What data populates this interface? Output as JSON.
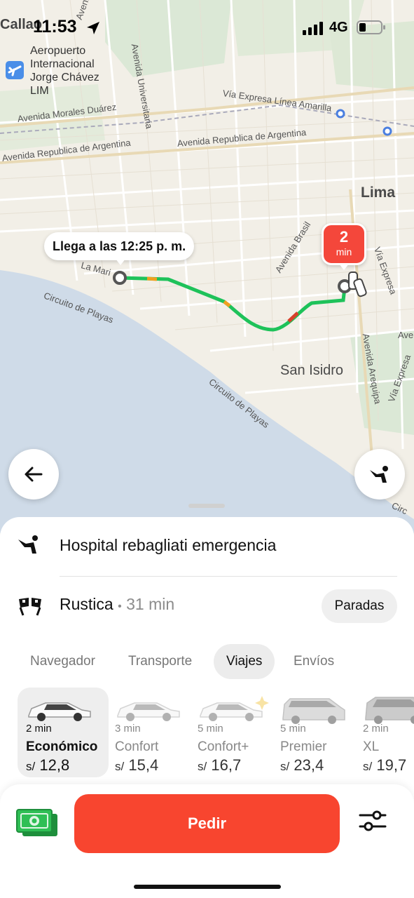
{
  "status_bar": {
    "time": "11:53",
    "network": "4G",
    "corner_label": "Callao"
  },
  "map": {
    "airport": {
      "line1": "Aeropuerto",
      "line2": "Internacional",
      "line3": "Jorge Chávez",
      "line4": "LIM"
    },
    "streets": {
      "avenida_1": "Avenida",
      "universitaria": "Avenida Universitaria",
      "linea_amarilla": "Vía Expresa Línea Amarilla",
      "morales_duarez": "Avenida Morales Duárez",
      "republica_1": "Avenida Republica de Argentina",
      "republica_2": "Avenida Republica de Argentina",
      "brasil": "Avenida Brasil",
      "via_expresa_1": "Vía Expresa",
      "via_expresa_2": "Vía Expresa",
      "arequipa": "Avenida Arequipa",
      "circuito_1": "Circuito de Playas",
      "circuito_2": "Circuito de Playas",
      "la_mar": "La Mari",
      "ave": "Ave",
      "circ": "Circ"
    },
    "city": "Lima",
    "district": "San Isidro",
    "eta_bubble": "Llega a las 12:25 p. m.",
    "pickup_badge": {
      "minutes": "2",
      "unit": "min"
    }
  },
  "route": {
    "from": "Hospital rebagliati emergencia",
    "to": "Rustica",
    "separator": "•",
    "duration": "31 min",
    "stops_button": "Paradas"
  },
  "tabs": [
    {
      "label": "Navegador",
      "active": false
    },
    {
      "label": "Transporte",
      "active": false
    },
    {
      "label": "Viajes",
      "active": true
    },
    {
      "label": "Envíos",
      "active": false
    }
  ],
  "tariffs": [
    {
      "eta": "2 min",
      "name": "Económico",
      "currency": "s/",
      "price": "12,8",
      "selected": true
    },
    {
      "eta": "3 min",
      "name": "Confort",
      "currency": "s/",
      "price": "15,4",
      "selected": false
    },
    {
      "eta": "5 min",
      "name": "Confort+",
      "currency": "s/",
      "price": "16,7",
      "selected": false
    },
    {
      "eta": "5 min",
      "name": "Premier",
      "currency": "s/",
      "price": "23,4",
      "selected": false
    },
    {
      "eta": "2 min",
      "name": "XL",
      "currency": "s/",
      "price": "19,7",
      "selected": false
    }
  ],
  "order_button": "Pedir",
  "colors": {
    "accent": "#f8452f",
    "route_green": "#1ec25a",
    "sea": "#cfdbe8",
    "map_land": "#f2efe7"
  },
  "icons": {
    "back": "arrow-left-icon",
    "pickup": "person-waving-icon",
    "destination": "checkered-flags-icon",
    "payment": "cash-icon",
    "options": "sliders-icon"
  }
}
